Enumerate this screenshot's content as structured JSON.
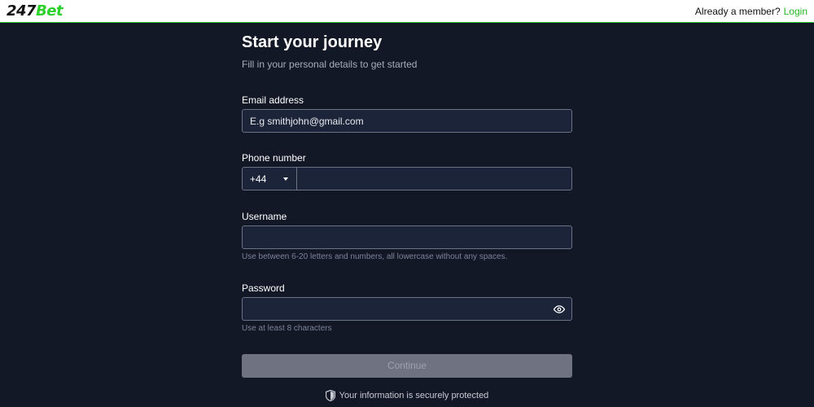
{
  "header": {
    "logo_number": "247",
    "logo_brand": "Bet",
    "member_text": "Already a member?",
    "login_label": "Login"
  },
  "form": {
    "title": "Start your journey",
    "subtitle": "Fill in your personal details to get started",
    "email": {
      "label": "Email address",
      "placeholder": "E.g smithjohn@gmail.com",
      "value": ""
    },
    "phone": {
      "label": "Phone number",
      "country_code": "+44",
      "value": ""
    },
    "username": {
      "label": "Username",
      "value": "",
      "hint": "Use between 6-20 letters and numbers, all lowercase without any spaces."
    },
    "password": {
      "label": "Password",
      "value": "",
      "hint": "Use at least 8 characters",
      "toggle_icon": "eye-icon"
    },
    "continue_label": "Continue",
    "secure_text": "Your information is securely protected"
  },
  "colors": {
    "accent": "#2bd12b",
    "background": "#121826",
    "input_bg": "#1c2439",
    "button_disabled": "#6f7281"
  }
}
